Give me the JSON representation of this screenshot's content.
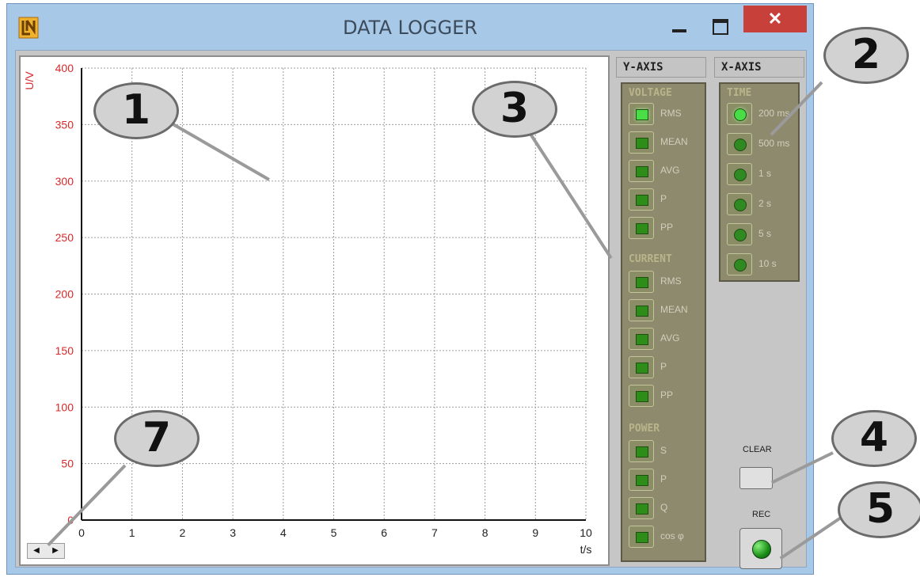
{
  "window": {
    "title": "DATA LOGGER",
    "controls": {
      "minimize": "—",
      "maximize": "☐",
      "close": "✕"
    }
  },
  "icons": {
    "logo": "app-logo-icon",
    "minimize": "minimize-icon",
    "maximize": "maximize-icon",
    "close": "close-icon",
    "scroll_left": "scroll-left-icon",
    "scroll_right": "scroll-right-icon"
  },
  "plot": {
    "y_axis_label": "U/V",
    "x_axis_label": "t/s",
    "y_ticks": [
      "0",
      "50",
      "100",
      "150",
      "200",
      "250",
      "300",
      "350",
      "400"
    ],
    "x_ticks": [
      "0",
      "1",
      "2",
      "3",
      "4",
      "5",
      "6",
      "7",
      "8",
      "9",
      "10"
    ],
    "ylim": [
      0,
      400
    ],
    "xlim": [
      0,
      10
    ],
    "grid": "dotted",
    "tick_color": "#d62a2a",
    "grid_color": "#9d9d9d"
  },
  "y_axis_panel": {
    "title": "Y-AXIS",
    "groups": [
      {
        "label": "VOLTAGE",
        "items": [
          {
            "label": "RMS",
            "active": true
          },
          {
            "label": "MEAN",
            "active": false
          },
          {
            "label": "AVG",
            "active": false
          },
          {
            "label": "P",
            "active": false
          },
          {
            "label": "PP",
            "active": false
          }
        ]
      },
      {
        "label": "CURRENT",
        "items": [
          {
            "label": "RMS",
            "active": false
          },
          {
            "label": "MEAN",
            "active": false
          },
          {
            "label": "AVG",
            "active": false
          },
          {
            "label": "P",
            "active": false
          },
          {
            "label": "PP",
            "active": false
          }
        ]
      },
      {
        "label": "POWER",
        "items": [
          {
            "label": "S",
            "active": false
          },
          {
            "label": "P",
            "active": false
          },
          {
            "label": "Q",
            "active": false
          },
          {
            "label": "cos φ",
            "active": false
          }
        ]
      }
    ]
  },
  "x_axis_panel": {
    "title": "X-AXIS",
    "group_label": "TIME",
    "items": [
      {
        "label": "200 ms",
        "active": true
      },
      {
        "label": "500 ms",
        "active": false
      },
      {
        "label": "1 s",
        "active": false
      },
      {
        "label": "2 s",
        "active": false
      },
      {
        "label": "5 s",
        "active": false
      },
      {
        "label": "10 s",
        "active": false
      }
    ]
  },
  "actions": {
    "clear_label": "CLEAR",
    "rec_label": "REC"
  },
  "callouts": {
    "one": "1",
    "two": "2",
    "three": "3",
    "four": "4",
    "five": "5",
    "seven": "7"
  }
}
